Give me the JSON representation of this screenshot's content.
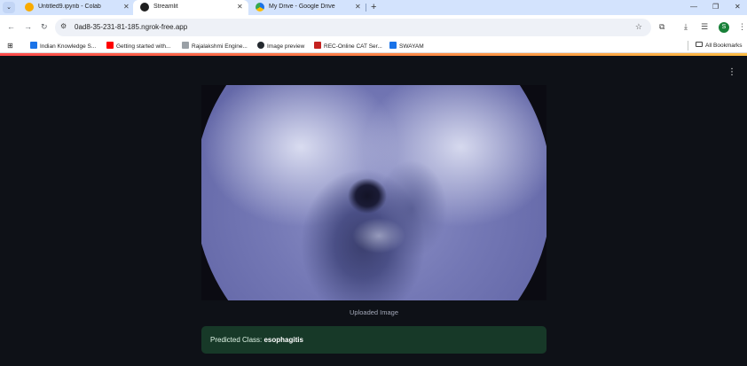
{
  "browser": {
    "tabs": [
      {
        "title": "Untitled9.ipynb - Colab",
        "favicon": "colab-icon",
        "active": false
      },
      {
        "title": "Streamlit",
        "favicon": "streamlit-icon",
        "active": true
      },
      {
        "title": "My Drive - Google Drive",
        "favicon": "google-drive-icon",
        "active": false
      }
    ],
    "address_bar": {
      "url": "0ad8-35-231-81-185.ngrok-free.app"
    },
    "bookmarks": [
      {
        "label": "Indian Knowledge S...",
        "icon": "swayam-icon"
      },
      {
        "label": "Getting started with...",
        "icon": "youtube-icon"
      },
      {
        "label": "Rajalakshmi Engine...",
        "icon": "page-icon"
      },
      {
        "label": "Image preview",
        "icon": "github-icon"
      },
      {
        "label": "REC-Online CAT Ser...",
        "icon": "rec-icon"
      },
      {
        "label": "SWAYAM",
        "icon": "swayam-icon"
      }
    ],
    "all_bookmarks_label": "All Bookmarks",
    "profile_initial": "S"
  },
  "app": {
    "image_caption": "Uploaded Image",
    "prediction": {
      "prefix": "Predicted Class: ",
      "value": "esophagitis"
    },
    "colors": {
      "background": "#0e1117",
      "success_bg": "#173928",
      "header_gradient_start": "#ff4b4b",
      "header_gradient_end": "#ffbd45"
    }
  }
}
